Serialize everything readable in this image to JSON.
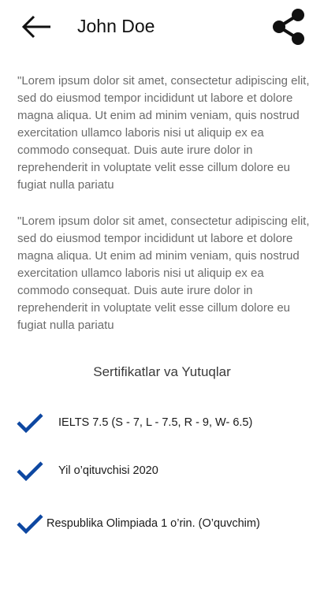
{
  "header": {
    "back_icon": "arrow-left-icon",
    "title": "John Doe",
    "share_icon": "share-icon"
  },
  "content": {
    "paragraphs": [
      "\"Lorem ipsum dolor sit amet, consectetur adipiscing elit, sed do eiusmod tempor incididunt ut labore et dolore magna aliqua. Ut enim ad minim veniam, quis nostrud exercitation ullamco laboris nisi ut aliquip ex ea commodo consequat. Duis aute irure dolor in reprehenderit in voluptate velit esse cillum dolore eu fugiat nulla pariatu",
      "\"Lorem ipsum dolor sit amet, consectetur adipiscing elit, sed do eiusmod tempor incididunt ut labore et dolore magna aliqua. Ut enim ad minim veniam, quis nostrud exercitation ullamco laboris nisi ut aliquip ex ea commodo consequat. Duis aute irure dolor in reprehenderit in voluptate velit esse cillum dolore eu fugiat nulla pariatu"
    ]
  },
  "achievements": {
    "title": "Sertifikatlar va Yutuqlar",
    "check_icon": "checkmark-icon",
    "check_color": "#0d47a1",
    "items": [
      {
        "label": "IELTS 7.5 (S - 7, L - 7.5, R - 9, W- 6.5)"
      },
      {
        "label": "Yil o’qituvchisi 2020"
      },
      {
        "label": "Respublika Olimpiada 1 o’rin. (O’quvchim)"
      }
    ]
  }
}
